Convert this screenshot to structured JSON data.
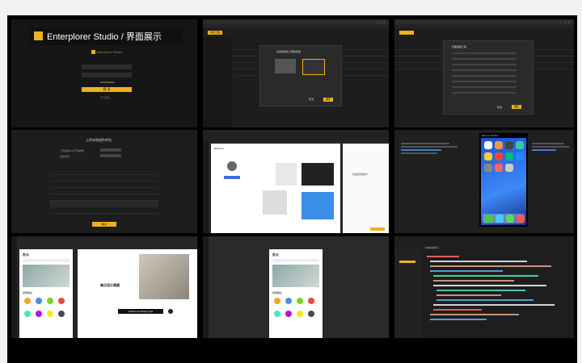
{
  "hero": {
    "brand": "Enterplorer Studio",
    "separator": "/",
    "subtitle": "界面展示",
    "logo_small": "Enterplorer Studio"
  },
  "tiles": {
    "login": {
      "button": "登 录",
      "link": "忘记密码"
    },
    "project_table": {
      "new_button": "新建工程",
      "modal_title": "请选择新建工程的类型",
      "ok": "确定",
      "cancel": "取消"
    },
    "list_modal": {
      "title": "界面截图工程",
      "ok": "确定",
      "cancel": "取消"
    },
    "upload": {
      "title": "上传本地组件库包",
      "row1": "上传组件Link产品参数",
      "row2": "选择目录",
      "btn": "确 定"
    },
    "designer": {
      "card_title": "Behance",
      "phrase": "欢迎来到官方!"
    },
    "ios": {
      "title": "iPhone 6S Plus"
    },
    "mobile_app": {
      "app_title": "办公",
      "card_title": "每日设计美图",
      "card_subtitle": "Passion & Design spot",
      "section_title": "发现精彩"
    },
    "preview": {
      "app_title": "办公",
      "section_title": "发现精彩"
    },
    "code": {
      "tab": "index.html"
    }
  },
  "colors": {
    "accent": "#f0b020",
    "bg": "#1d1d1d"
  }
}
